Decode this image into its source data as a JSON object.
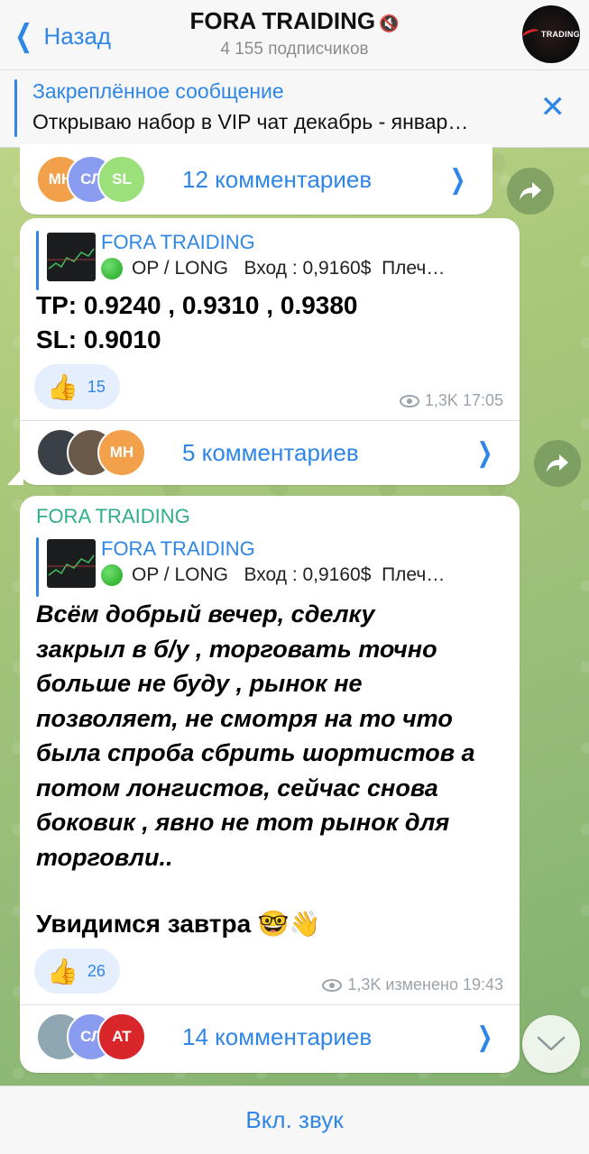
{
  "header": {
    "back_label": "Назад",
    "title": "FORA TRAIDING",
    "subscribers": "4 155 подписчиков",
    "avatar_text": "TRADING"
  },
  "pinned": {
    "title": "Закреплённое сообщение",
    "text": "Открываю набор в VIP чат декабрь - январ…"
  },
  "posts": [
    {
      "comments": {
        "avatars": [
          "МН",
          "СЛ",
          "SL"
        ],
        "label": "12 комментариев"
      }
    },
    {
      "quote": {
        "title": "FORA TRAIDING",
        "line": "OP / LONG   Вход : 0,9160$  Плеч…"
      },
      "lines": [
        "TP: 0.9240 , 0.9310 , 0.9380",
        "SL: 0.9010"
      ],
      "reaction": {
        "emoji": "👍",
        "count": "15"
      },
      "meta": {
        "views": "1,3K",
        "time": "17:05"
      },
      "comments": {
        "avatars": [
          "",
          "",
          "МН"
        ],
        "label": "5 комментариев"
      }
    },
    {
      "forwarded_from": "FORA TRAIDING",
      "quote": {
        "title": "FORA TRAIDING",
        "line": "OP / LONG   Вход : 0,9160$  Плеч…"
      },
      "lines": [
        "Всём добрый вечер, сделку",
        "закрыл в б/у , торговать точно",
        "больше не буду , рынок не",
        "позволяет, не смотря на то что",
        "была спроба сбрить шортистов а",
        "потом лонгистов, сейчас снова",
        "боковик , явно не тот рынок для",
        "торговли.."
      ],
      "closing": "Увидимся завтра 🤓👋",
      "reaction": {
        "emoji": "👍",
        "count": "26"
      },
      "meta": {
        "views": "1,3K",
        "time": "изменено 19:43"
      },
      "comments": {
        "avatars": [
          "",
          "СЛ",
          "AT"
        ],
        "label": "14 комментариев"
      }
    }
  ],
  "bottom": {
    "unmute_label": "Вкл. звук"
  },
  "colors": {
    "accent": "#2f86e6",
    "forward_name": "#2fae8a",
    "reaction_bg": "#e4eefc"
  }
}
